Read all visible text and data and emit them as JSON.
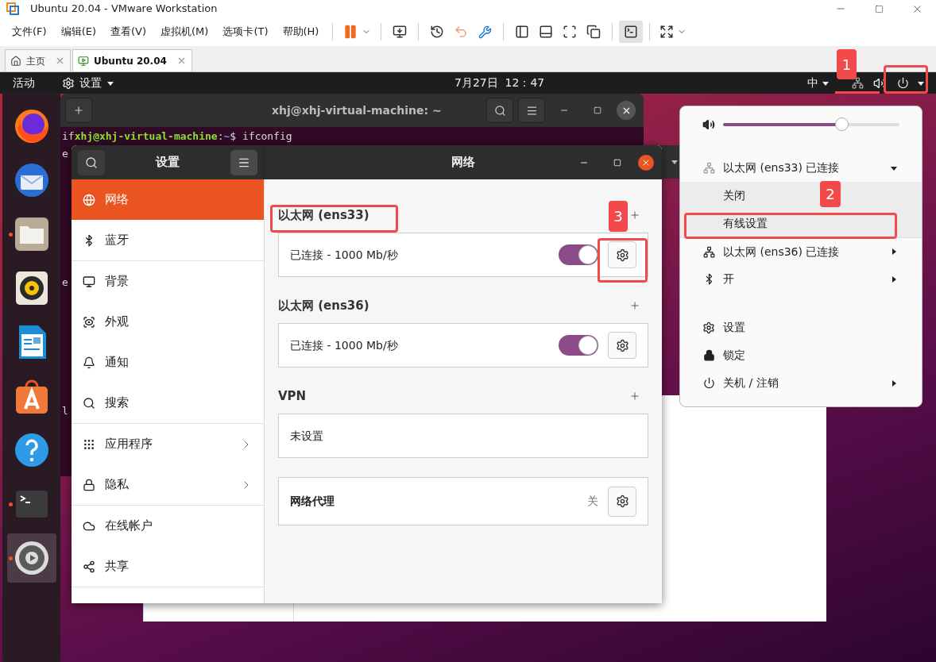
{
  "app_window": {
    "title": "Ubuntu 20.04 - VMware Workstation"
  },
  "menu": [
    "文件(F)",
    "编辑(E)",
    "查看(V)",
    "虚拟机(M)",
    "选项卡(T)",
    "帮助(H)"
  ],
  "tabs": [
    {
      "label": "主页",
      "selected": false
    },
    {
      "label": "Ubuntu 20.04",
      "selected": true
    }
  ],
  "top_bar": {
    "activities": "活动",
    "app_menu": "设置",
    "clock": "7月27日  12：47",
    "input_method": "中"
  },
  "dock": [
    {
      "running": false,
      "selected": false
    },
    {
      "running": false,
      "selected": false
    },
    {
      "running": true,
      "selected": false
    },
    {
      "running": false,
      "selected": false
    },
    {
      "running": false,
      "selected": false
    },
    {
      "running": false,
      "selected": false
    },
    {
      "running": false,
      "selected": false
    },
    {
      "running": true,
      "selected": false
    },
    {
      "running": true,
      "selected": true
    }
  ],
  "terminal": {
    "title": "xhj@xhj-virtual-machine: ~",
    "prompt": {
      "typed": "if",
      "user_host": "xhj@xhj-virtual-machine",
      "separator": ":",
      "path": "~",
      "command": "$ ifconfig"
    },
    "fragments": [
      "e",
      "e",
      "l"
    ]
  },
  "settings": {
    "title": "设置",
    "page_title": "网络",
    "sidebar": [
      {
        "label": "网络",
        "selected": true,
        "has_submenu": false
      },
      {
        "label": "蓝牙",
        "selected": false,
        "has_submenu": false
      },
      {
        "label": "背景",
        "selected": false,
        "has_submenu": false
      },
      {
        "label": "外观",
        "selected": false,
        "has_submenu": false
      },
      {
        "label": "通知",
        "selected": false,
        "has_submenu": false
      },
      {
        "label": "搜索",
        "selected": false,
        "has_submenu": false
      },
      {
        "label": "应用程序",
        "selected": false,
        "has_submenu": true
      },
      {
        "label": "隐私",
        "selected": false,
        "has_submenu": true
      },
      {
        "label": "在线帐户",
        "selected": false,
        "has_submenu": false
      },
      {
        "label": "共享",
        "selected": false,
        "has_submenu": false
      }
    ],
    "sections": [
      {
        "title": "以太网 (ens33)",
        "rows": [
          {
            "kind": "connection",
            "label": "已连接 - 1000 Mb/秒",
            "on": true
          }
        ]
      },
      {
        "title": "以太网 (ens36)",
        "rows": [
          {
            "kind": "connection",
            "label": "已连接 - 1000 Mb/秒",
            "on": true
          }
        ]
      },
      {
        "title": "VPN",
        "rows": [
          {
            "kind": "empty",
            "label": "未设置"
          }
        ]
      },
      {
        "rows": [
          {
            "kind": "proxy",
            "label": "网络代理",
            "value": "关"
          }
        ]
      }
    ]
  },
  "system_menu": {
    "volume": {
      "level": 0.69
    },
    "items": [
      {
        "kind": "network",
        "label": "以太网 (ens33) 已连接",
        "expanded": true
      },
      {
        "kind": "sub",
        "label": "关闭"
      },
      {
        "kind": "sub",
        "label": "有线设置"
      },
      {
        "kind": "network",
        "label": "以太网 (ens36) 已连接",
        "expanded": false
      },
      {
        "kind": "bluetooth",
        "label": "开",
        "expanded": false
      },
      {
        "kind": "separator"
      },
      {
        "kind": "action",
        "label": "设置"
      },
      {
        "kind": "action",
        "label": "锁定"
      },
      {
        "kind": "action",
        "label": "关机 / 注销",
        "has_submenu": true
      }
    ]
  },
  "annotations": [
    {
      "label": "1"
    },
    {
      "label": "2"
    },
    {
      "label": "3"
    }
  ]
}
